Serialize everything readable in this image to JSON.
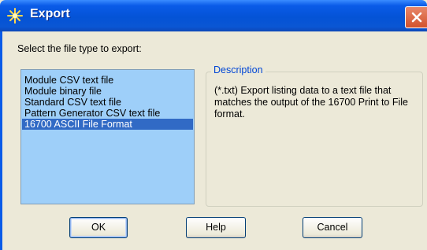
{
  "window": {
    "title": "Export",
    "icon": "sparkle-icon",
    "close_icon": "close-icon"
  },
  "prompt": "Select the file type to export:",
  "file_types": {
    "items": [
      "Module CSV text file",
      "Module binary file",
      "Standard CSV text file",
      "Pattern Generator CSV text file",
      "16700 ASCII File Format"
    ],
    "selected_index": 4
  },
  "description": {
    "label": "Description",
    "text": "(*.txt) Export listing data to a text file that matches the output of the 16700 Print to File format."
  },
  "buttons": {
    "ok": "OK",
    "help": "Help",
    "cancel": "Cancel"
  },
  "colors": {
    "title_bar": "#0453d6",
    "list_background": "#9ecff9",
    "selection": "#316ac5",
    "legend_text": "#0046d5",
    "close_button": "#d2522c"
  }
}
